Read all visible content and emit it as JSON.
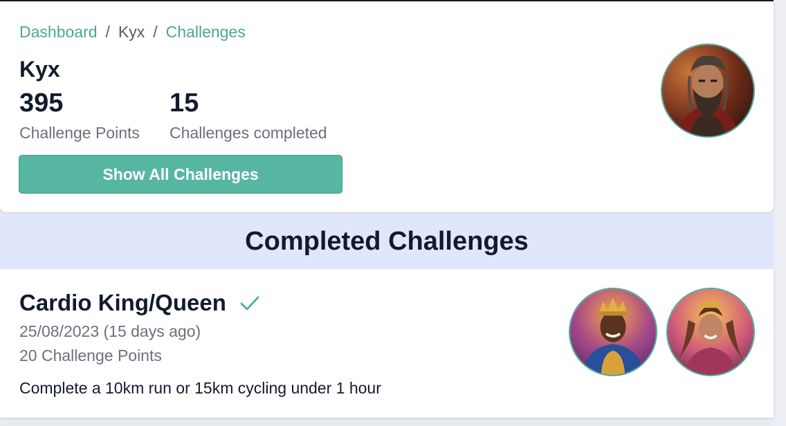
{
  "breadcrumb": {
    "items": [
      "Dashboard",
      "Kyx",
      "Challenges"
    ],
    "separator": "/"
  },
  "profile": {
    "name": "Kyx",
    "stats": [
      {
        "value": "395",
        "label": "Challenge Points"
      },
      {
        "value": "15",
        "label": "Challenges completed"
      }
    ],
    "show_all_label": "Show All Challenges",
    "avatar_icon": "warrior-avatar"
  },
  "completed": {
    "heading": "Completed Challenges",
    "challenges": [
      {
        "title": "Cardio King/Queen",
        "date": "25/08/2023 (15 days ago)",
        "points": "20 Challenge Points",
        "description": "Complete a 10km run or 15km cycling under 1 hour",
        "badges": [
          "king-avatar",
          "queen-avatar"
        ]
      }
    ]
  },
  "colors": {
    "accent": "#48a891",
    "button": "#57b6a2",
    "section_bg": "#e0e6fb",
    "text_dark": "#121a2e",
    "text_muted": "#6a707c"
  }
}
